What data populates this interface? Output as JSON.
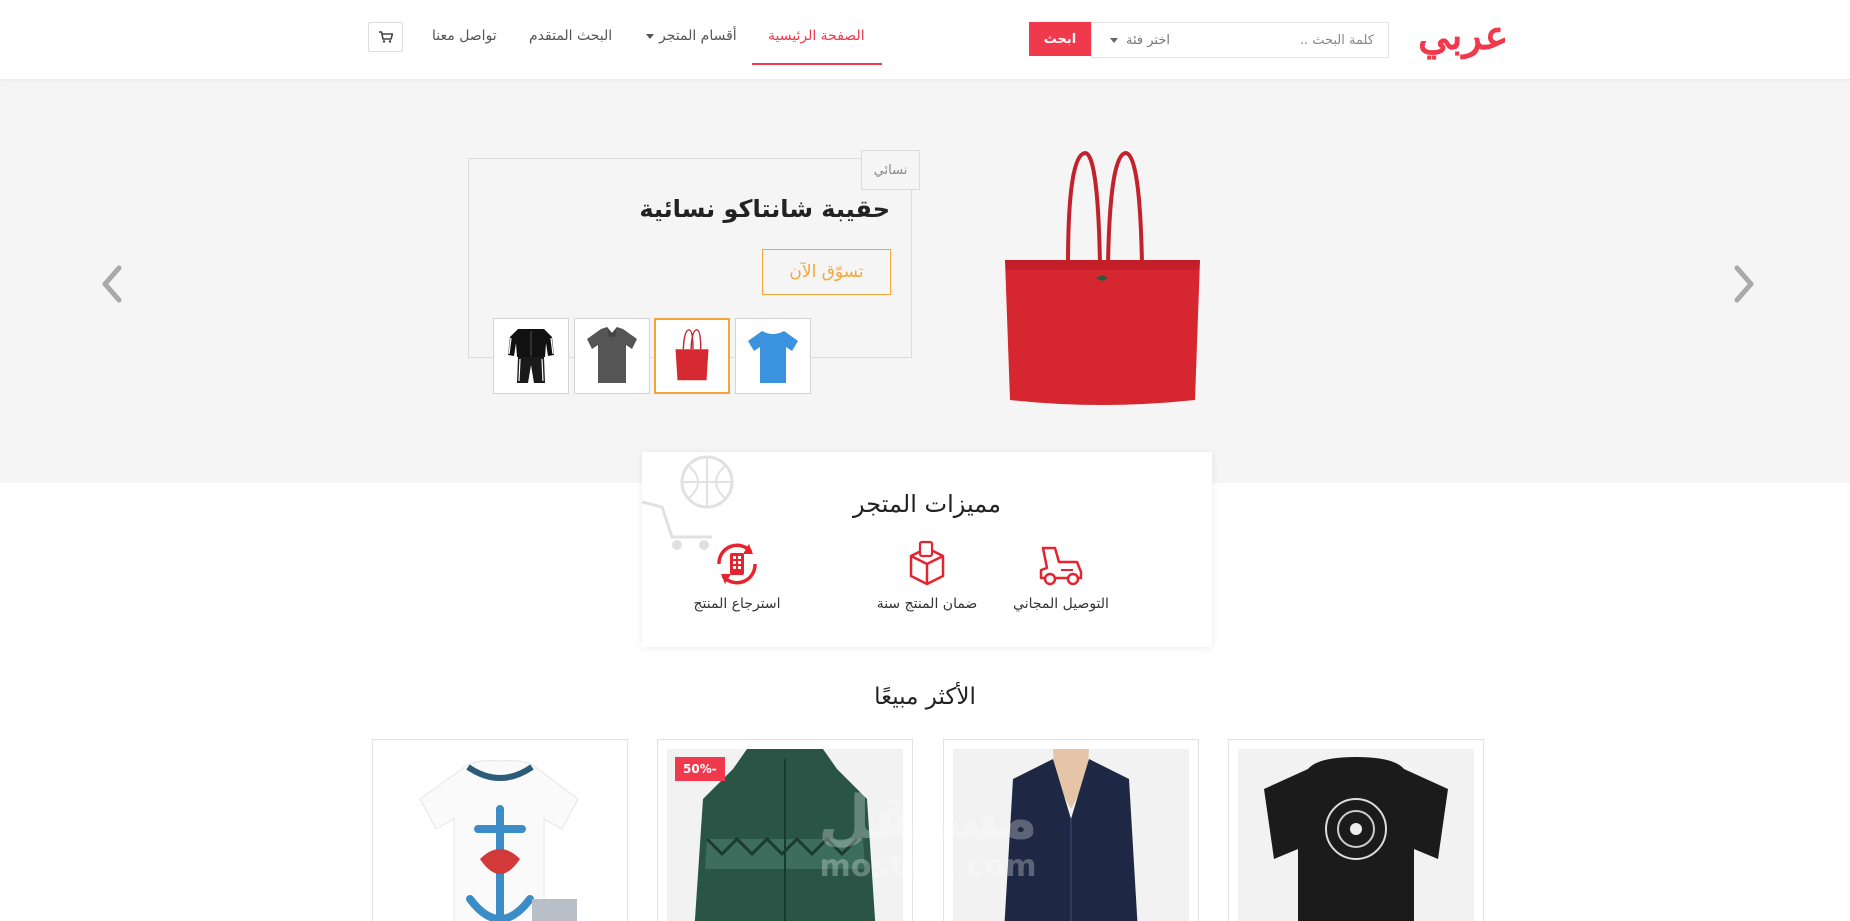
{
  "header": {
    "logo": "عربي",
    "search": {
      "placeholder": "كلمة البحث ..",
      "category_label": "اختر فئة",
      "button_label": "ابحث"
    },
    "nav": {
      "home": "الصفحة الرئيسية",
      "store_sections": "أقسام المتجر",
      "advanced_search": "البحث المتقدم",
      "contact": "تواصل معنا"
    },
    "cart_icon": "cart-icon"
  },
  "hero": {
    "tag": "نسائي",
    "title": "حقيبة شانتاكو نسائية",
    "cta": "تسوّق الآن",
    "thumbnails": [
      "tracksuit-black",
      "polo-gray",
      "bag-red",
      "tshirt-blue"
    ],
    "active_thumbnail": 2,
    "prev_icon": "chevron-left-icon",
    "next_icon": "chevron-right-icon"
  },
  "features": {
    "title": "مميزات المتجر",
    "items": [
      {
        "label": "التوصيل المجاني",
        "icon": "delivery-vehicle-icon"
      },
      {
        "label": "ضمان المنتج سنة",
        "icon": "package-box-icon"
      },
      {
        "label": "استرجاع المنتج",
        "icon": "return-refresh-icon"
      }
    ]
  },
  "best_sellers": {
    "title": "الأكثر مبيعًا",
    "products": [
      {
        "name": "tshirt-black-mandala"
      },
      {
        "name": "blouse-navy"
      },
      {
        "name": "jacket-green",
        "badge": "50%-"
      },
      {
        "name": "kids-shirt-anchor"
      }
    ]
  },
  "watermark": {
    "ar": "مستقل",
    "en": "mostaql.com"
  },
  "colors": {
    "accent": "#f0394d",
    "cta": "#f2a73a",
    "hero_bg": "#f5f5f5"
  }
}
